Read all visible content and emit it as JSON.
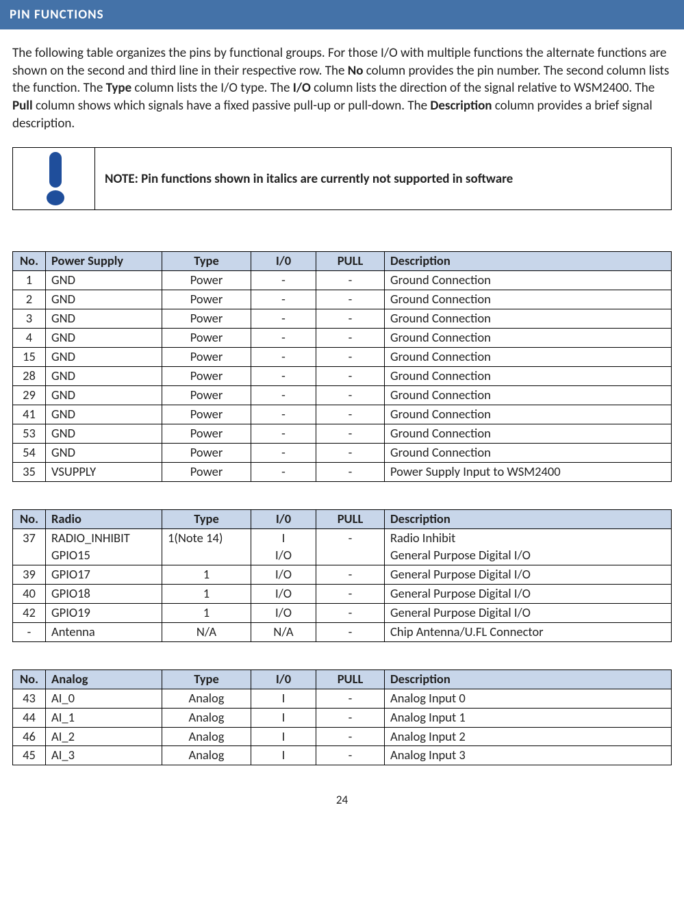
{
  "banner": "PIN FUNCTIONS",
  "intro_parts": [
    "The following table organizes the pins by functional groups. For those I/O with multiple functions the alternate functions are shown on the second and third line in their respective row. The ",
    "No",
    " column provides the pin number. The second column lists the function. The ",
    "Type",
    " column lists the I/O type. The ",
    "I/O",
    " column lists the direction of the signal relative to WSM2400. The ",
    "Pull",
    " column shows which signals have a fixed passive pull-up or pull-down. The ",
    "Description",
    " column provides a brief signal description."
  ],
  "note_text": "NOTE: Pin functions shown in italics are currently not supported in software",
  "headers": {
    "no": "No.",
    "type": "Type",
    "io": "I/0",
    "pull": "PULL",
    "desc": "Description"
  },
  "tables": [
    {
      "name_header": "Power Supply",
      "rows": [
        {
          "no": "1",
          "name": "GND",
          "type": "Power",
          "io": "-",
          "pull": "-",
          "desc": "Ground Connection"
        },
        {
          "no": "2",
          "name": "GND",
          "type": "Power",
          "io": "-",
          "pull": "-",
          "desc": "Ground Connection"
        },
        {
          "no": "3",
          "name": "GND",
          "type": "Power",
          "io": "-",
          "pull": "-",
          "desc": "Ground Connection"
        },
        {
          "no": "4",
          "name": "GND",
          "type": "Power",
          "io": "-",
          "pull": "-",
          "desc": "Ground Connection"
        },
        {
          "no": "15",
          "name": "GND",
          "type": "Power",
          "io": "-",
          "pull": "-",
          "desc": "Ground Connection"
        },
        {
          "no": "28",
          "name": "GND",
          "type": "Power",
          "io": "-",
          "pull": "-",
          "desc": "Ground Connection"
        },
        {
          "no": "29",
          "name": "GND",
          "type": "Power",
          "io": "-",
          "pull": "-",
          "desc": "Ground Connection"
        },
        {
          "no": "41",
          "name": "GND",
          "type": "Power",
          "io": "-",
          "pull": "-",
          "desc": "Ground Connection"
        },
        {
          "no": "53",
          "name": "GND",
          "type": "Power",
          "io": "-",
          "pull": "-",
          "desc": "Ground Connection"
        },
        {
          "no": "54",
          "name": "GND",
          "type": "Power",
          "io": "-",
          "pull": "-",
          "desc": "Ground Connection"
        },
        {
          "no": "35",
          "name": "VSUPPLY",
          "type": "Power",
          "io": "-",
          "pull": "-",
          "desc": "Power Supply Input to WSM2400"
        }
      ]
    },
    {
      "name_header": "Radio",
      "rows": [
        {
          "no": "37",
          "name": "RADIO_INHIBIT\nGPIO15",
          "type": "1(Note 14)",
          "type_left": true,
          "io": "I\nI/O",
          "pull": "-",
          "desc": "Radio Inhibit\nGeneral Purpose Digital I/O",
          "vcenter": true
        },
        {
          "no": "39",
          "name": "GPIO17",
          "type": "1",
          "io": "I/O",
          "pull": "-",
          "desc": "General Purpose Digital I/O"
        },
        {
          "no": "40",
          "name": "GPIO18",
          "type": "1",
          "io": "I/O",
          "pull": "-",
          "desc": "General Purpose Digital I/O"
        },
        {
          "no": "42",
          "name": "GPIO19",
          "type": "1",
          "io": "I/O",
          "pull": "-",
          "desc": "General Purpose Digital I/O"
        },
        {
          "no": "-",
          "name": "Antenna",
          "type": "N/A",
          "io": "N/A",
          "pull": "-",
          "desc": "Chip Antenna/U.FL Connector"
        }
      ]
    },
    {
      "name_header": "Analog",
      "rows": [
        {
          "no": "43",
          "name": "AI_0",
          "type": "Analog",
          "io": "I",
          "pull": "-",
          "desc": "Analog Input 0"
        },
        {
          "no": "44",
          "name": "AI_1",
          "type": "Analog",
          "io": "I",
          "pull": "-",
          "desc": "Analog Input 1"
        },
        {
          "no": "46",
          "name": "AI_2",
          "type": "Analog",
          "io": "I",
          "pull": "-",
          "desc": "Analog Input 2"
        },
        {
          "no": "45",
          "name": "AI_3",
          "type": "Analog",
          "io": "I",
          "pull": "-",
          "desc": "Analog Input 3"
        }
      ]
    }
  ],
  "page_number": "24"
}
